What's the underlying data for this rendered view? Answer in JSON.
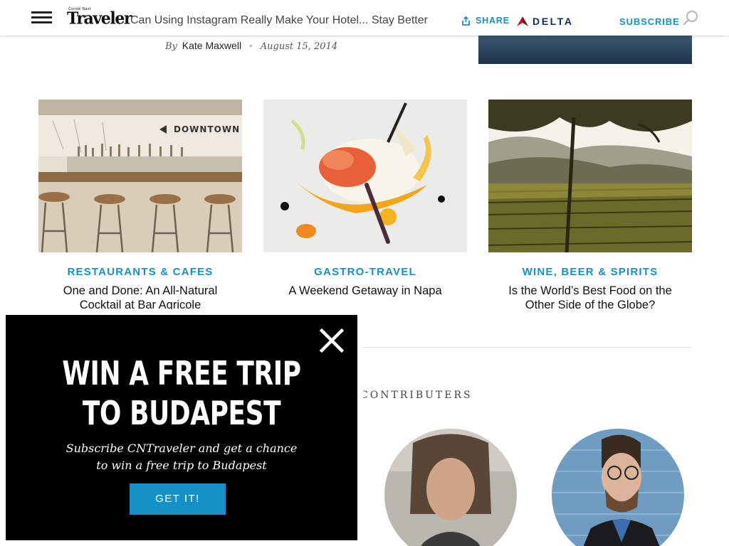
{
  "header": {
    "logo_top": "Condé Nast",
    "logo_main": "Traveler",
    "article_title": "Can Using Instagram Really Make Your Hotel... Stay Better",
    "share_label": "SHARE",
    "sponsor": "DELTA",
    "subscribe_label": "SUBSCRIBE",
    "icons": [
      "hamburger-icon",
      "share-icon",
      "delta-logo-icon",
      "search-icon"
    ]
  },
  "byline": {
    "by": "By",
    "author": "Kate Maxwell",
    "separator": "•",
    "date": "August 15, 2014"
  },
  "cards": [
    {
      "category": "RESTAURANTS & CAFES",
      "title": "One and Done: An All-Natural Cocktail at Bar Agricole",
      "sign_text": "DOWNTOWN"
    },
    {
      "category": "GASTRO-TRAVEL",
      "title": "A Weekend Getaway in Napa"
    },
    {
      "category": "WINE, BEER & SPIRITS",
      "title": "Is the World’s Best Food on the Other Side of the Globe?"
    }
  ],
  "contributors": {
    "heading": "CONTRIBUTERS"
  },
  "modal": {
    "headline_line1": "WIN A FREE TRIP",
    "headline_line2": "TO BUDAPEST",
    "sub_line1": "Subscribe CNTraveler and get a chance",
    "sub_line2": "to win a free trip to Budapest",
    "cta_label": "GET IT!"
  },
  "colors": {
    "accent": "#1591c7",
    "delta_navy": "#0f2a5c",
    "delta_red": "#c8102e",
    "modal_bg": "#000000"
  }
}
